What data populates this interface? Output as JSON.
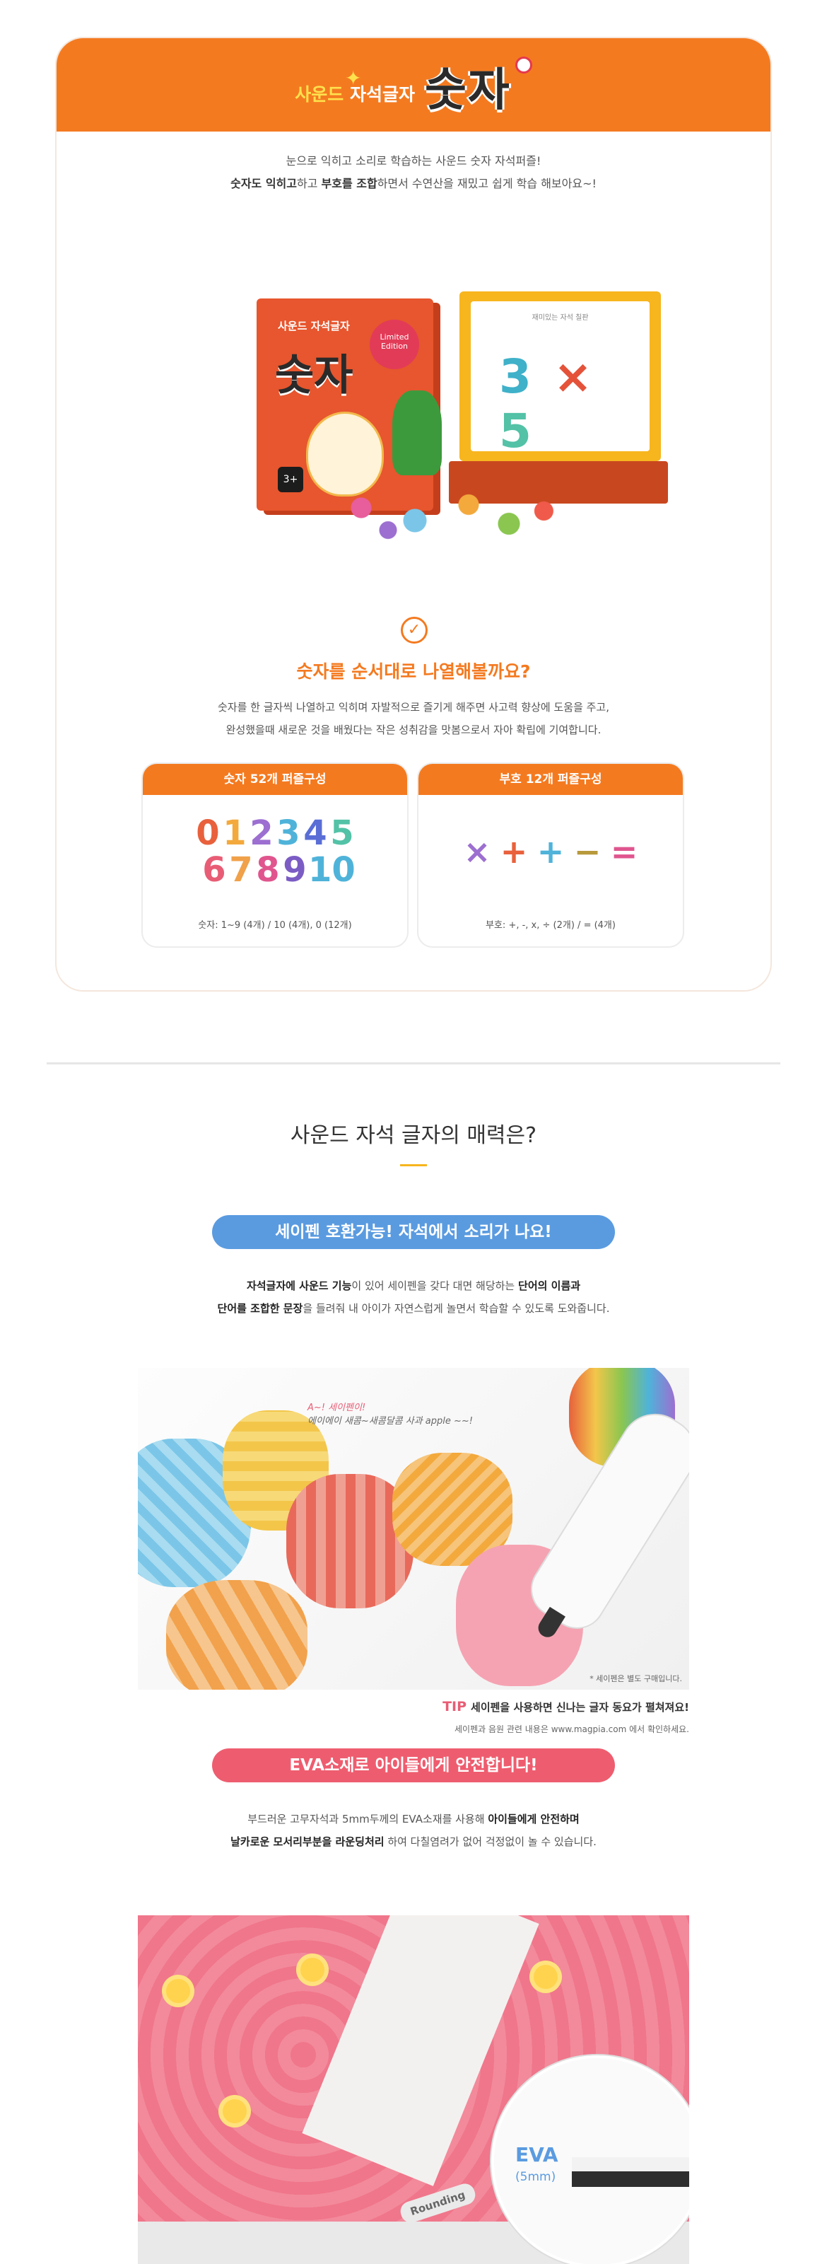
{
  "header": {
    "subtitle_prefix": "사운드",
    "subtitle_rest": "자석글자",
    "title": "숫자"
  },
  "intro": {
    "line1": "눈으로 익히고 소리로 학습하는 사운드 숫자 자석퍼즐!",
    "line2_bold1": "숫자도 익히고",
    "line2_bold2": "부호를 조합",
    "line2_rest": "하면서 수연산을 재밌고 쉽게 학습 해보아요~!"
  },
  "product": {
    "book_subtitle": "사운드 자석글자",
    "book_title": "숫자",
    "book_tag": "Limited Edition",
    "age": "3+",
    "board_label": "재미있는 자석 칠판",
    "equation": {
      "n1": "3",
      "op": "×",
      "n2": "5"
    }
  },
  "question": {
    "check_icon": "check-circle-icon",
    "title": "숫자를 순서대로 나열해볼까요?",
    "line1": "숫자를 한 글자씩 나열하고 익히며 자발적으로 즐기게 해주면 사고력 향상에 도움을 주고,",
    "line2": "완성했을때 새로운 것을 배웠다는 작은 성취감을 맛봄으로서 자아 확립에 기여합니다."
  },
  "panels": {
    "numbers": {
      "title": "숫자 52개 퍼즐구성",
      "row1": [
        "0",
        "1",
        "2",
        "3",
        "4",
        "5"
      ],
      "row2": [
        "6",
        "7",
        "8",
        "9",
        "10"
      ],
      "note": "숫자: 1~9 (4개) / 10 (4개), 0 (12개)"
    },
    "symbols": {
      "title": "부호 12개 퍼즐구성",
      "items": [
        "×",
        "+",
        "+",
        "−",
        "="
      ],
      "note": "부호: +, -, x, ÷ (2개) / = (4개)"
    }
  },
  "section2": {
    "title": "사운드 자석 글자의 매력은?",
    "feature1": {
      "pill": "세이펜 호환가능! 자석에서 소리가 나요!",
      "line1_bold": "자석글자에 사운드 기능",
      "line1_mid": "이 있어 세이펜을 갖다 대면 해당하는 ",
      "line1_bold2": "단어의 이름과",
      "line2_bold": "단어를 조합한 문장",
      "line2_rest": "을 들려줘 내 아이가 자연스럽게 놀면서 학습할 수 있도록 도와줍니다.",
      "bubble1": "A~! 세이펜이!",
      "bubble2": "에이에이 새콤~새콤달콤 사과 apple ~~!",
      "photo_note": "* 세이펜은 별도 구매입니다.",
      "tip_label": "TIP",
      "tip_text": "세이펜을 사용하면 신나는 글자 동요가 펼쳐져요!",
      "tip_sub": "세이펜과 음원 관련 내용은 www.magpia.com 에서 확인하세요."
    },
    "feature2": {
      "pill": "EVA소재로 아이들에게 안전합니다!",
      "line1_rest": "부드러운 고무자석과 5mm두께의 EVA소재를 사용해 ",
      "line1_bold": "아이들에게 안전하며",
      "line2_bold": "날카로운 모서리부분을 라운딩처리",
      "line2_rest": " 하여 다칠염려가 없어 걱정없이 놀 수 있습니다.",
      "rounding_label": "Rounding",
      "eva_label": "EVA",
      "eva_mm": "(5mm)"
    }
  },
  "colors": {
    "accent": "#f47a20",
    "blue": "#5a9be0",
    "pink": "#ee5d6f",
    "digit_colors": [
      "#e8613c",
      "#f3a93c",
      "#9c6fd1",
      "#4fb3d9",
      "#5a6ed6",
      "#53c2a6",
      "#e85d75",
      "#f0a14a",
      "#e0558e",
      "#7b5cc4",
      "#4fb3d9"
    ],
    "symbol_colors": [
      "#9c6fd1",
      "#e8613c",
      "#4fb3d9",
      "#b89a3c",
      "#e0558e"
    ]
  }
}
